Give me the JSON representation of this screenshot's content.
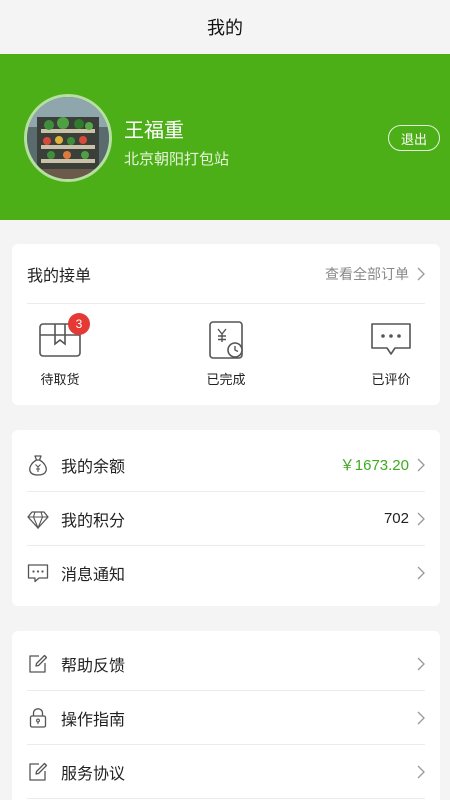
{
  "header": {
    "title": "我的"
  },
  "profile": {
    "name": "王福重",
    "station": "北京朝阳打包站",
    "logout_label": "退出"
  },
  "orders": {
    "title": "我的接单",
    "view_all": "查看全部订单",
    "items": [
      {
        "label": "待取货",
        "badge": "3",
        "icon": "package-icon"
      },
      {
        "label": "已完成",
        "icon": "receipt-clock-icon"
      },
      {
        "label": "已评价",
        "icon": "chat-bubble-icon"
      }
    ]
  },
  "wallet": {
    "balance_label": "我的余额",
    "balance_value": "￥1673.20",
    "points_label": "我的积分",
    "points_value": "702",
    "messages_label": "消息通知"
  },
  "help": {
    "feedback_label": "帮助反馈",
    "guide_label": "操作指南",
    "agreement_label": "服务协议"
  },
  "colors": {
    "brand_green": "#4caf18",
    "badge_red": "#e53935",
    "value_green": "#3eaa1f"
  }
}
